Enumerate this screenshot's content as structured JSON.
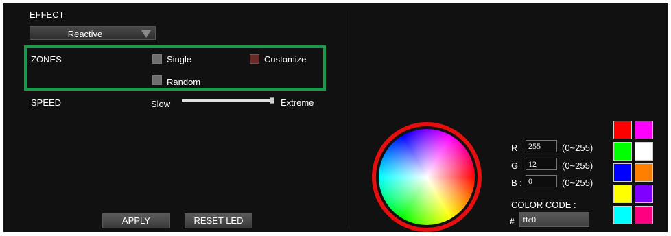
{
  "effect": {
    "label": "EFFECT",
    "selected": "Reactive"
  },
  "zones": {
    "label": "ZONES",
    "options": [
      {
        "label": "Single",
        "checked": false
      },
      {
        "label": "Customize",
        "checked": true
      },
      {
        "label": "Random",
        "checked": false
      }
    ]
  },
  "speed": {
    "label": "SPEED",
    "min_label": "Slow",
    "max_label": "Extreme",
    "value_fraction": 1.0
  },
  "buttons": {
    "apply": "APPLY",
    "reset": "RESET LED"
  },
  "rgb": {
    "r_label": "R",
    "r_value": "255",
    "r_range": "(0~255)",
    "g_label": "G",
    "g_value": "12",
    "g_range": "(0~255)",
    "b_label": "B :",
    "b_value": "0",
    "b_range": "(0~255)"
  },
  "color_code": {
    "label": "COLOR CODE :",
    "hash": "#",
    "value": "ffc0"
  },
  "swatches": [
    "#ff0000",
    "#ff00ff",
    "#00ff00",
    "#ffffff",
    "#0000ff",
    "#ff7f00",
    "#ffff00",
    "#7f00ff",
    "#00ffff",
    "#ff0080"
  ]
}
